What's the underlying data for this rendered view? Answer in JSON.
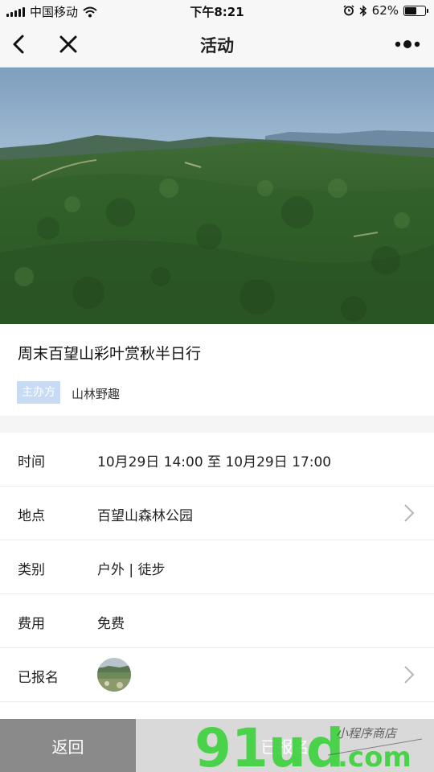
{
  "status_bar": {
    "carrier": "中国移动",
    "time": "下午8:21",
    "battery_percent": "62%",
    "battery_level": 0.62
  },
  "nav": {
    "title": "活动",
    "back_icon": "chevron-left-icon",
    "close_icon": "close-icon",
    "more_icon": "more-dots-icon"
  },
  "activity": {
    "title": "周末百望山彩叶赏秋半日行",
    "organizer_tag": "主办方",
    "organizer_name": "山林野趣"
  },
  "info": {
    "time": {
      "label": "时间",
      "value": "10月29日 14:00 至 10月29日 17:00"
    },
    "location": {
      "label": "地点",
      "value": "百望山森林公园"
    },
    "category": {
      "label": "类别",
      "value": "户外 | 徒步"
    },
    "fee": {
      "label": "费用",
      "value": "免费"
    },
    "registered": {
      "label": "已报名"
    }
  },
  "bottom": {
    "back_label": "返回",
    "signup_label": "已报名"
  },
  "watermark": {
    "brand": "91ud",
    "domain": ".com",
    "tagline": "小程序商店"
  },
  "colors": {
    "organizer_tag_bg": "#c7dcf4",
    "back_button_bg": "#8a8a8a",
    "signup_button_bg": "#d9d9d9",
    "watermark_green": "#3bd23b"
  }
}
